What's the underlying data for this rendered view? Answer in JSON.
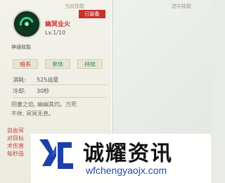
{
  "header": {
    "current_skill_label": "当前技能",
    "selected_skill_label": "选中技能"
  },
  "skill": {
    "name": "幽冥业火",
    "level": "Lv.1/10",
    "equipped_badge": "已装备",
    "category": "神通技能",
    "tags": [
      "暗系",
      "单体",
      "持续"
    ],
    "cost_label": "消耗:",
    "cost_value": "525战意",
    "cooldown_label": "冷却:",
    "cooldown_value": "30秒",
    "description_lines": [
      "阴曹之焰, 幽幽其灼。万死",
      "不休, 冥冥无息。"
    ],
    "effect_lines": [
      "自由冥",
      "对目标",
      "术伤害",
      "每秒造"
    ]
  },
  "watermark": {
    "text": "诚耀资讯",
    "url": "wfchengyaojx.com"
  },
  "colors": {
    "equipped_badge_bg": "#c4342d",
    "skill_name": "#cc3333",
    "tag_dark": "#c9372c",
    "tag_green": "#2d8a6a",
    "logo_blue": "#1f3fa8"
  },
  "icons": {
    "skill_icon": "green-flame-swirl-icon",
    "logo": "yc-logo-icon"
  }
}
